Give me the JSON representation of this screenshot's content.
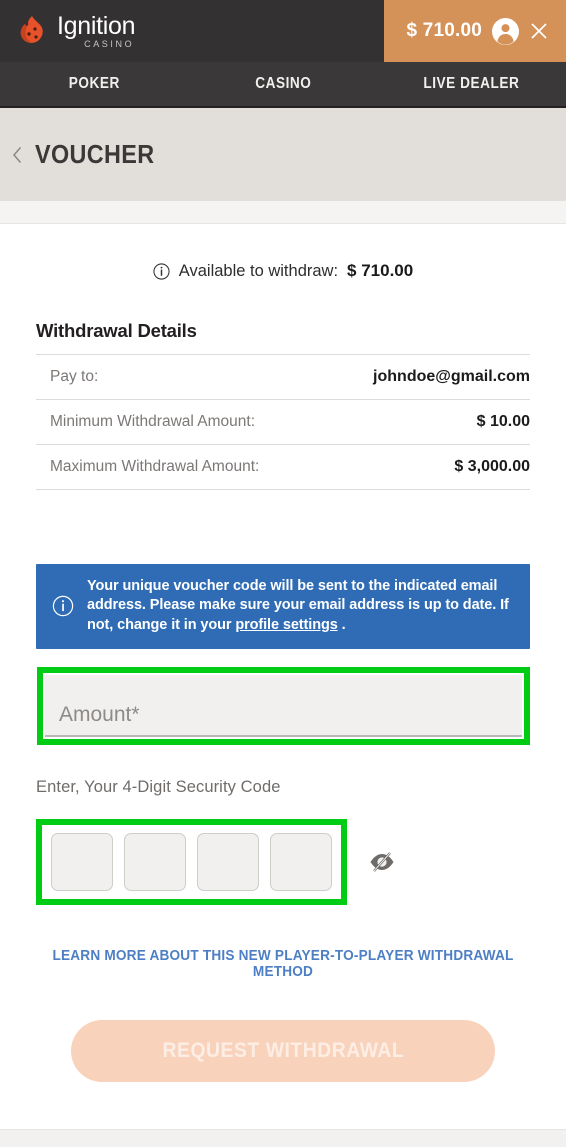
{
  "header": {
    "logo_name": "Ignition",
    "logo_sub": "CASINO",
    "logo_icon": "flame-dice-logo-icon",
    "balance": "$ 710.00",
    "avatar_icon": "user-avatar-icon",
    "close_icon": "close-icon"
  },
  "nav": {
    "items": [
      {
        "label": "POKER"
      },
      {
        "label": "CASINO"
      },
      {
        "label": "LIVE DEALER"
      }
    ]
  },
  "page_header": {
    "back_icon": "chevron-left-icon",
    "title": "VOUCHER"
  },
  "available": {
    "info_icon": "info-circle-icon",
    "label": "Available to withdraw:",
    "amount": "$ 710.00"
  },
  "details": {
    "title": "Withdrawal Details",
    "rows": [
      {
        "key": "Pay to:",
        "value": "johndoe@gmail.com"
      },
      {
        "key": "Minimum Withdrawal Amount:",
        "value": "$ 10.00"
      },
      {
        "key": "Maximum Withdrawal Amount:",
        "value": "$ 3,000.00"
      }
    ]
  },
  "notice": {
    "icon": "info-circle-icon",
    "text_before": "Your unique voucher code will be sent to the indicated email address. Please make sure your email address is up to date. If not, change it in your ",
    "link_text": "profile settings",
    "text_after": " ."
  },
  "amount_field": {
    "placeholder": "Amount*",
    "value": ""
  },
  "security": {
    "label": "Enter, Your 4-Digit Security Code",
    "digits": [
      "",
      "",
      "",
      ""
    ],
    "toggle_icon": "eye-off-icon"
  },
  "learn_more": {
    "label": "LEARN MORE ABOUT THIS NEW PLAYER-TO-PLAYER WITHDRAWAL METHOD"
  },
  "submit": {
    "label": "REQUEST WITHDRAWAL"
  },
  "colors": {
    "header_bg": "#333132",
    "nav_bg": "#3a3838",
    "balance_bg": "#d59258",
    "title_bar_bg": "#e2dfdb",
    "notice_bg": "#2f6cb5",
    "annotation_green": "#00cc14",
    "link_blue": "#4d7fc4",
    "button_bg": "#f9d2bc"
  }
}
